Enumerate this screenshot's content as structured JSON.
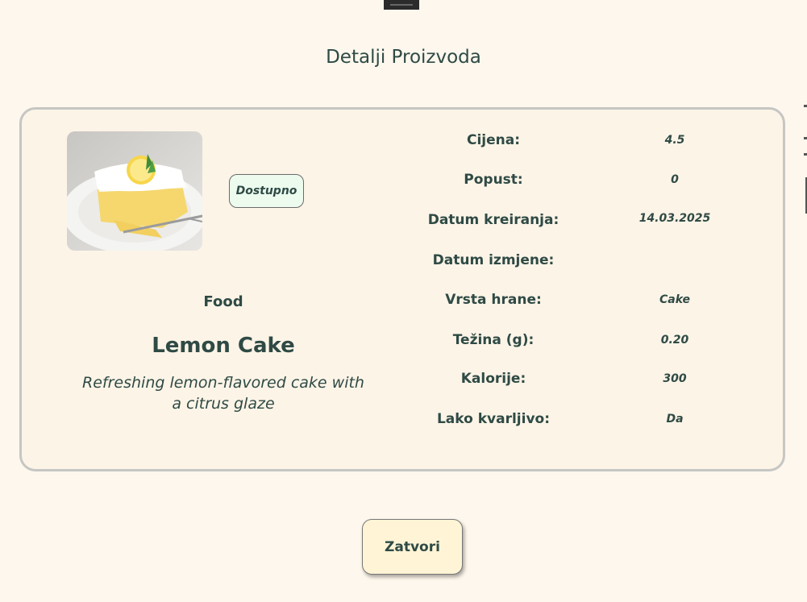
{
  "page_title": "Detalji Proizvoda",
  "product": {
    "image_alt": "Lemon Cake",
    "status": "Dostupno",
    "category": "Food",
    "name": "Lemon Cake",
    "description": "Refreshing lemon-flavored cake with a citrus glaze"
  },
  "details": [
    {
      "label": "Cijena:",
      "value": "4.5"
    },
    {
      "label": "Popust:",
      "value": "0"
    },
    {
      "label": "Datum kreiranja:",
      "value": "14.03.2025"
    },
    {
      "label": "Datum izmjene:",
      "value": ""
    },
    {
      "label": "Vrsta hrane:",
      "value": "Cake"
    },
    {
      "label": "Težina (g):",
      "value": "0.20"
    },
    {
      "label": "Kalorije:",
      "value": "300"
    },
    {
      "label": "Lako kvarljivo:",
      "value": "Da"
    }
  ],
  "buttons": {
    "close_label": "Zatvori"
  },
  "colors": {
    "background": "#fdf7ed",
    "card": "#fcf4e7",
    "badge": "#ecfbee",
    "text": "#2f4a45",
    "button": "#fff4d6"
  }
}
